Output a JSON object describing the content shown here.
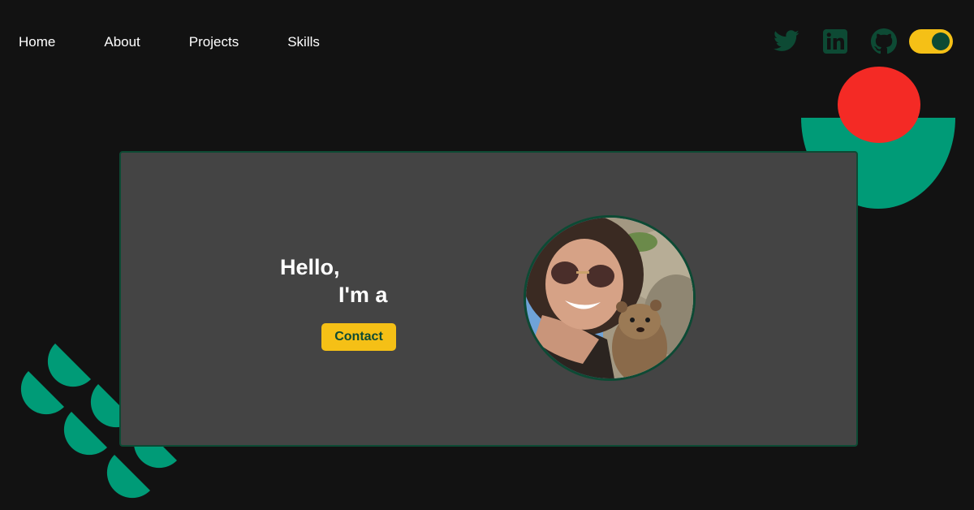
{
  "nav": {
    "items": [
      {
        "label": "Home"
      },
      {
        "label": "About"
      },
      {
        "label": "Projects"
      },
      {
        "label": "Skills"
      }
    ]
  },
  "social": {
    "icons": [
      "twitter-icon",
      "linkedin-icon",
      "github-icon"
    ],
    "theme_toggle": {
      "state": "on"
    }
  },
  "hero": {
    "greeting_line1": "Hello,",
    "greeting_line2": "I'm a",
    "contact_label": "Contact"
  },
  "colors": {
    "background": "#121212",
    "card": "#444444",
    "accent_green": "#009b77",
    "dark_green": "#0d4a34",
    "yellow": "#f5c016",
    "red": "#f42a25",
    "text": "#ffffff"
  }
}
